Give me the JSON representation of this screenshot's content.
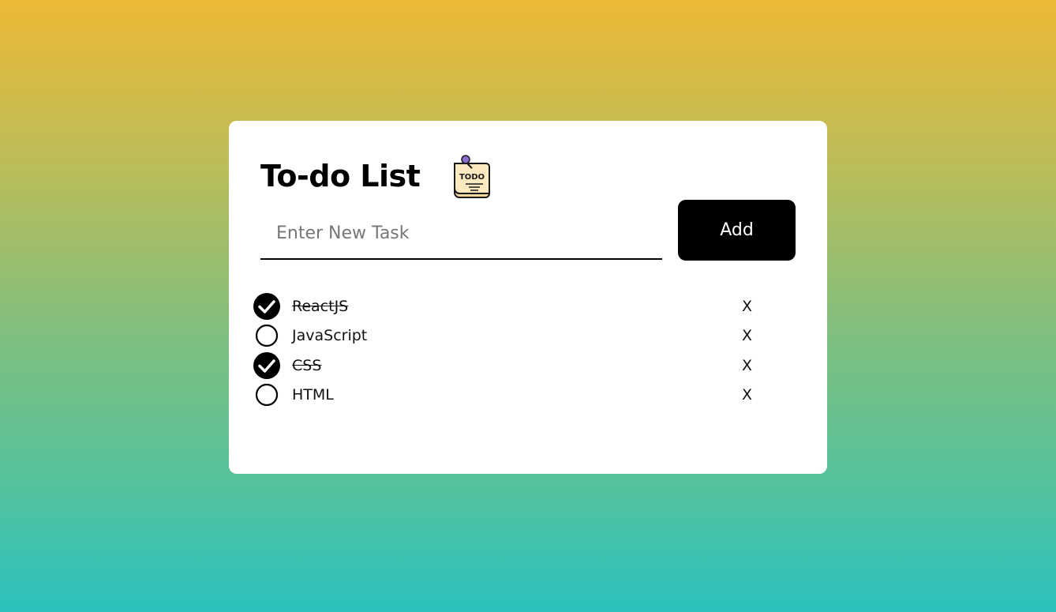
{
  "app": {
    "title": "To-do List",
    "icon": "todo-note-icon",
    "icon_text": "TODO"
  },
  "input": {
    "placeholder": "Enter New Task",
    "value": ""
  },
  "add_button": {
    "label": "Add"
  },
  "tasks": [
    {
      "label": "ReactJS",
      "checked": true,
      "delete_label": "X"
    },
    {
      "label": "JavaScript",
      "checked": false,
      "delete_label": "X"
    },
    {
      "label": "CSS",
      "checked": true,
      "delete_label": "X"
    },
    {
      "label": "HTML",
      "checked": false,
      "delete_label": "X"
    }
  ],
  "colors": {
    "gradient_top": "#edb936",
    "gradient_bottom": "#2bc1be",
    "card": "#ffffff",
    "button": "#000000",
    "icon_paper": "#fde9c0",
    "icon_pin": "#8e6bd1"
  }
}
